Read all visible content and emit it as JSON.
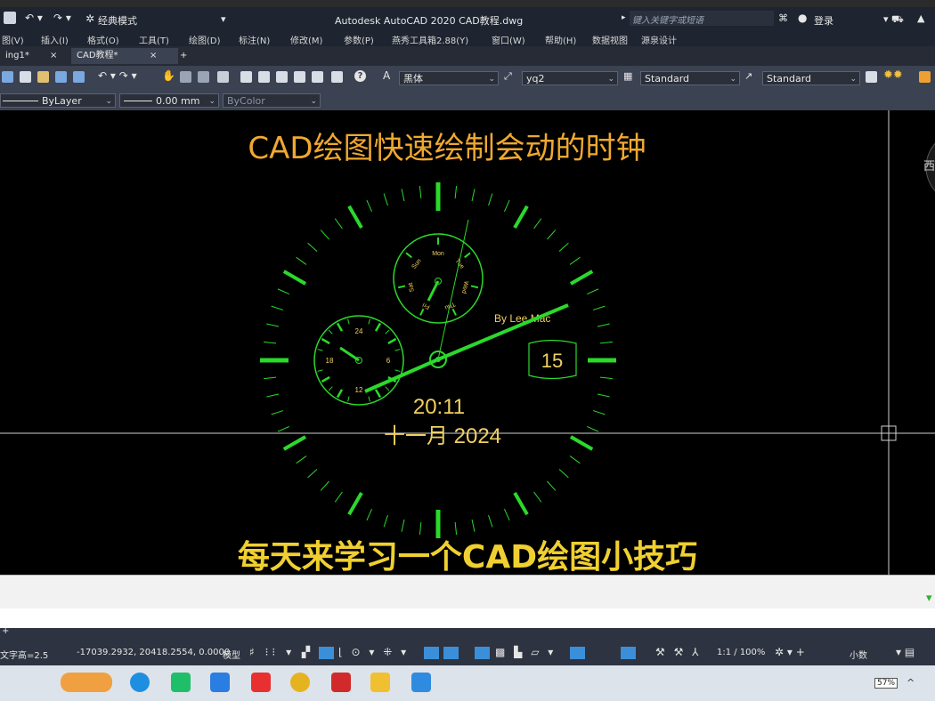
{
  "titlebar": {
    "workspace": "经典模式",
    "app_title": "Autodesk AutoCAD 2020   CAD教程.dwg",
    "search_placeholder": "键入关键字或短语",
    "login": "登录"
  },
  "menu": [
    "图(V)",
    "插入(I)",
    "格式(O)",
    "工具(T)",
    "绘图(D)",
    "标注(N)",
    "修改(M)",
    "参数(P)",
    "燕秀工具箱2.88(Y)",
    "窗口(W)",
    "帮助(H)",
    "数据视图",
    "源泉设计"
  ],
  "tabs": [
    {
      "label": "ing1*",
      "close": "×"
    },
    {
      "label": "CAD教程*",
      "close": "×"
    },
    {
      "label": "+"
    }
  ],
  "toolbar": {
    "font": "黑体",
    "text_style": "yq2",
    "dim_style": "Standard",
    "table_style": "Standard"
  },
  "properties": {
    "linetype": "ByLayer",
    "lineweight": "0.00 mm",
    "color": "ByColor"
  },
  "canvas": {
    "headline": "CAD绘图快速绘制会动的时钟",
    "footer": "每天来学习一个CAD绘图小技巧",
    "viewcube_label": "西",
    "colors": {
      "accent": "#f0a830",
      "clock_green": "#2bd92b",
      "text_yellow": "#f0d060"
    }
  },
  "clock": {
    "weekdays": [
      "Mon",
      "Tue",
      "Wed",
      "Thu",
      "Fri",
      "Sat",
      "Sun"
    ],
    "hour24_labels": [
      "24",
      "6",
      "12",
      "18"
    ],
    "author": "By Lee Mac",
    "date_day": "15",
    "time": "20:11",
    "month_year": "十一月  2024"
  },
  "status": {
    "left_text": "文字高=2.5",
    "coords": "-17039.2932, 20418.2554, 0.0000",
    "model": "模型",
    "scale": "1:1 / 100%",
    "units": "小数"
  },
  "taskbar": {
    "battery": "57%"
  }
}
